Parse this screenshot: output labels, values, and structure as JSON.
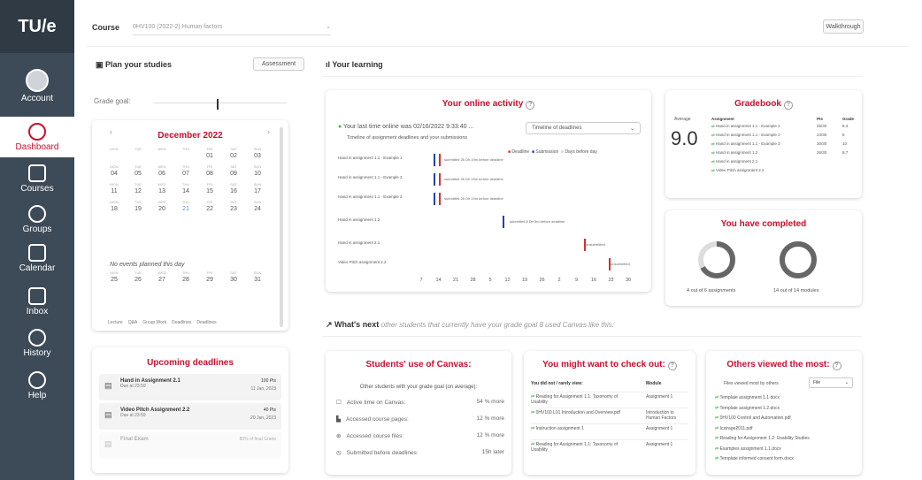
{
  "nav": {
    "logo": "TU/e",
    "items": [
      "Account",
      "Dashboard",
      "Courses",
      "Groups",
      "Calendar",
      "Inbox",
      "History",
      "Help"
    ]
  },
  "header": {
    "course_label": "Course",
    "course_value": "0HV100 (2022-2) Human factors",
    "walkthrough": "Walkthrough"
  },
  "plan": {
    "title": "Plan your studies",
    "assessment": "Assessment",
    "grade_goal": "Grade goal:"
  },
  "calendar": {
    "month": "December 2022",
    "days": [
      "MON",
      "TUE",
      "WED",
      "THU",
      "FRI",
      "SAT",
      "SUN"
    ],
    "weeks": [
      [
        "",
        "",
        "",
        "",
        "01",
        "02",
        "03"
      ],
      [
        "04",
        "05",
        "06",
        "07",
        "08",
        "09",
        "10"
      ],
      [
        "11",
        "12",
        "13",
        "14",
        "15",
        "16",
        "17"
      ],
      [
        "18",
        "19",
        "20",
        "21",
        "22",
        "23",
        "24"
      ],
      [
        "25",
        "26",
        "27",
        "28",
        "29",
        "30",
        "31"
      ]
    ],
    "no_events": "No events planned this day",
    "legend": [
      "Lecture",
      "Q&A",
      "Group Work",
      "Deadlines",
      "Deadlines"
    ]
  },
  "deadlines": {
    "title": "Upcoming deadlines",
    "items": [
      {
        "name": "Hand in Assignment 2.1",
        "due": "Due at 23:59",
        "pts": "100 Pts",
        "date": "11 Jan, 2023"
      },
      {
        "name": "Video Pitch Assignment 2.2",
        "due": "Due at 23:59",
        "pts": "40 Pts",
        "date": "20 Jan, 2023"
      },
      {
        "name": "Final Exam",
        "due": "",
        "pts": "80% of final Grade",
        "date": ""
      }
    ]
  },
  "learning": {
    "title": "Your learning"
  },
  "activity": {
    "title": "Your online activity",
    "last_online": "Your last time online was 02/16/2022 9:33:40 ...",
    "subtitle": "Timeline of assignment deadlines and your submissions",
    "select": "Timeline of deadlines",
    "legend": [
      "Deadline",
      "Submission",
      "Days before day"
    ],
    "rows": [
      {
        "label": "Hand in assignment 1.1 - Example 1",
        "note": "submitted 26 Dh 19m before deadline"
      },
      {
        "label": "Hand in assignment 1.1 - Example 2",
        "note": "submitted 26 Dh 19m before deadline"
      },
      {
        "label": "Hand in assignment 1.1 - Example 3",
        "note": "submitted 26 Dh 19m before deadline"
      },
      {
        "label": "Hand in assignment 1.2",
        "note": "submitted 8 Dh 5m before deadline"
      },
      {
        "label": "Hand in assignment 2.1",
        "note": "unsubmitted"
      },
      {
        "label": "Video Pitch assignment 2.2",
        "note": "unsubmitted"
      }
    ],
    "ticks": [
      "7",
      "14",
      "21",
      "28",
      "5",
      "12",
      "19",
      "26",
      "2",
      "9",
      "16",
      "23",
      "30"
    ]
  },
  "gradebook": {
    "title": "Gradebook",
    "avg_label": "Average",
    "avg": "9.0",
    "cols": [
      "Assignment",
      "Pts",
      "Grade"
    ],
    "rows": [
      [
        "Hand in assignment 1.1 - Example 1",
        "25/30",
        "8.3"
      ],
      [
        "Hand in assignment 1.1 - Example 2",
        "24/30",
        "8"
      ],
      [
        "Hand in assignment 1.1 - Example 3",
        "30/30",
        "10"
      ],
      [
        "Hand in assignment 1.2",
        "26/30",
        "8.7"
      ],
      [
        "Hand in assignment 2.1",
        "",
        ""
      ],
      [
        "Video Pitch assignment 2.2",
        "",
        ""
      ]
    ]
  },
  "completed": {
    "title": "You have completed",
    "a_text": "4 out of 6 assignments",
    "b_text": "14 out of 14 modules",
    "a_fraction": 0.67,
    "b_fraction": 1.0
  },
  "next": {
    "title": "What's next",
    "sub": "other students that currently have your grade goal 8 used Canvas like this:"
  },
  "usage": {
    "title": "Students' use of Canvas:",
    "sub": "Other students with your grade goal (on average):",
    "rows": [
      [
        "Active time on Canvas:",
        "54 % more"
      ],
      [
        "Accessed course pages:",
        "12 % more"
      ],
      [
        "Accessed course files:",
        "12 % more"
      ],
      [
        "Submitted before deadlines:",
        "15h later"
      ]
    ]
  },
  "checkout": {
    "title": "You might want to check out:",
    "cols": [
      "You did not / rarely view:",
      "Module"
    ],
    "rows": [
      [
        "Reading for Assignment 1.1: Taxonomy of Usability",
        "Assignment 1"
      ],
      [
        "0HV100 L01 Introduction and Overview.pdf",
        "Introduction to Human Factors"
      ],
      [
        "Instruction assignment 1",
        "Assignment 1"
      ],
      [
        "Reading for Assignment 1.1: Taxonomy of Usability",
        "Assignment 1"
      ]
    ]
  },
  "others": {
    "title": "Others viewed the most:",
    "label": "Files viewed most by others",
    "select": "File",
    "items": [
      "Template assignment 1.1.docx",
      "Template assignment 1.2.docx",
      "0HV100 Control and Automation.pdf",
      "Icstrage2011.pdf",
      "Reading for Assignment 1.2: Usability Studies",
      "Examples assignment 1.1.docx",
      "Template informed consent form.docx"
    ]
  },
  "colors": {
    "accent": "#c8102e",
    "nav": "#3d4a57",
    "deadline": "#d32f2f",
    "submission": "#2740a8"
  }
}
